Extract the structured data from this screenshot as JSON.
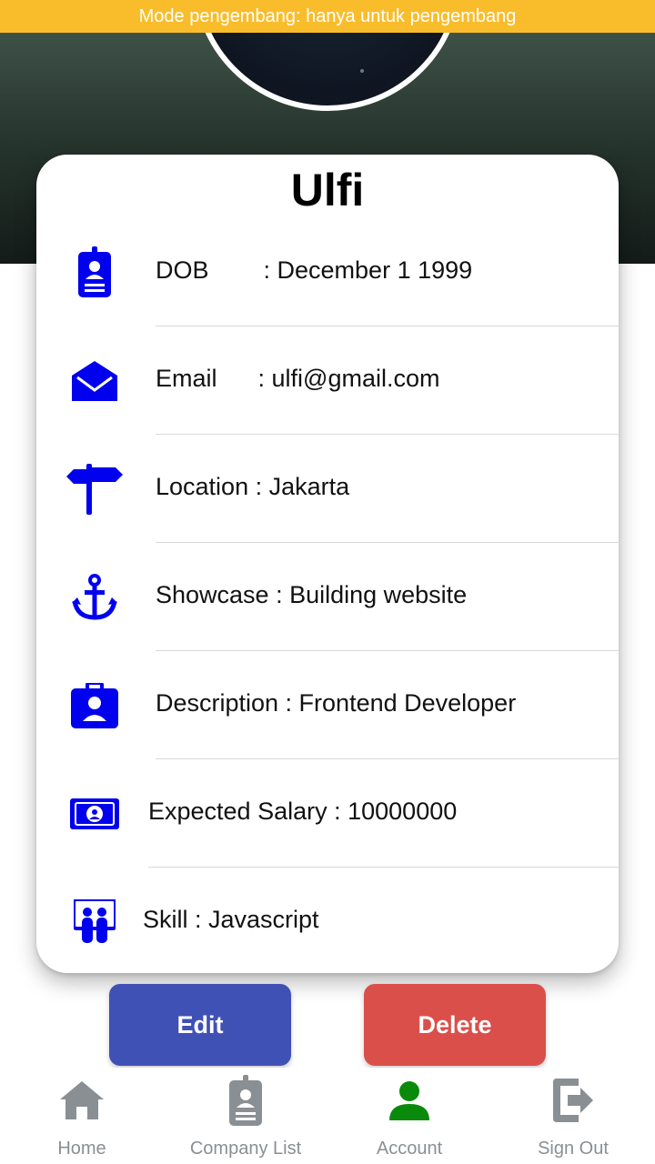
{
  "dev_banner": "Mode pengembang: hanya untuk pengembang",
  "profile": {
    "name": "Ulfi"
  },
  "details": [
    {
      "icon": "id-badge-icon",
      "label": "DOB        : December 1 1999"
    },
    {
      "icon": "envelope-open-icon",
      "label": "Email      : ulfi@gmail.com"
    },
    {
      "icon": "signpost-icon",
      "label": "Location : Jakarta"
    },
    {
      "icon": "anchor-icon",
      "label": "Showcase : Building website"
    },
    {
      "icon": "briefcase-user-icon",
      "label": "Description : Frontend Developer"
    },
    {
      "icon": "money-bill-icon",
      "label": "Expected Salary : 10000000"
    },
    {
      "icon": "presentation-icon",
      "label": "Skill : Javascript"
    }
  ],
  "actions": {
    "edit_label": "Edit",
    "delete_label": "Delete"
  },
  "nav": {
    "items": [
      {
        "label": "Home",
        "icon": "home-icon"
      },
      {
        "label": "Company List",
        "icon": "id-badge-icon"
      },
      {
        "label": "Account",
        "icon": "user-icon"
      },
      {
        "label": "Sign Out",
        "icon": "sign-out-icon"
      }
    ],
    "active": "Account"
  },
  "colors": {
    "banner": "#f9bd2b",
    "icon_blue": "#0000ee",
    "edit_button": "#3f51b5",
    "delete_button": "#db4f4a",
    "nav_active": "#0a8a0a",
    "nav_inactive": "#8a8f94"
  }
}
